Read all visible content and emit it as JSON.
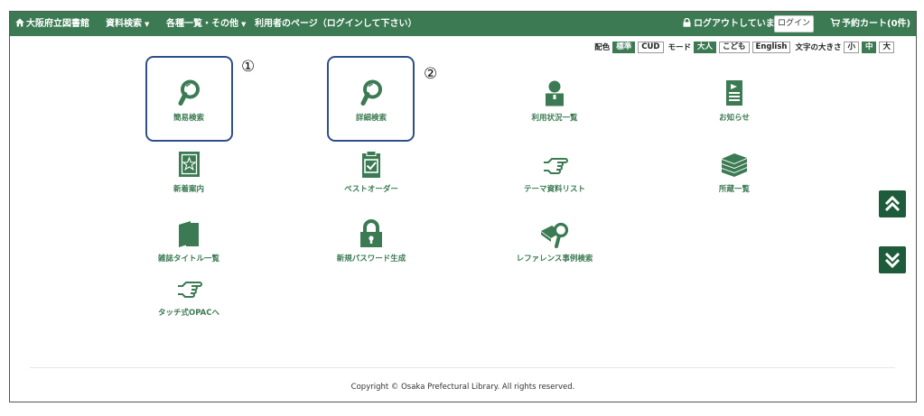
{
  "navbar": {
    "home": "大阪府立図書館",
    "search_menu": "資料検索",
    "lists_menu": "各種一覧・その他",
    "user_page": "利用者のページ（ログインして下さい）",
    "logout_status": "ログアウトしています",
    "login_button": "ログイン",
    "cart": "予約カート(0件)"
  },
  "settings": {
    "color_label": "配色",
    "color_options": [
      "標準",
      "CUD"
    ],
    "mode_label": "モード",
    "mode_options": [
      "大人",
      "こども",
      "English"
    ],
    "size_label": "文字の大きさ",
    "size_options": [
      "小",
      "中",
      "大"
    ],
    "selected_color": "標準",
    "selected_mode": "大人",
    "selected_size": "中"
  },
  "menu": {
    "simple_search": "簡易検索",
    "detail_search": "詳細検索",
    "usage_status": "利用状況一覧",
    "notices": "お知らせ",
    "new_arrivals": "新着案内",
    "best_order": "ベストオーダー",
    "theme_list": "テーマ資料リスト",
    "holdings": "所蔵一覧",
    "magazine_titles": "雑誌タイトル一覧",
    "new_password": "新規パスワード生成",
    "reference_search": "レファレンス事例検索",
    "touch_opac": "タッチ式OPACへ"
  },
  "annotations": {
    "one": "①",
    "two": "②"
  },
  "footer": {
    "copyright": "Copyright © Osaka Prefectural Library. All rights reserved."
  },
  "colors": {
    "brand_green": "#3b7a52",
    "highlight_blue": "#2f4f88",
    "scroll_green": "#1e5b3a"
  },
  "icons": {
    "simple_search": "magnifier-icon",
    "detail_search": "magnifier-icon",
    "usage_status": "person-icon",
    "notices": "notice-document-icon",
    "new_arrivals": "star-book-icon",
    "best_order": "clipboard-check-icon",
    "theme_list": "pointing-hand-icon",
    "holdings": "book-stack-icon",
    "magazine_titles": "magazine-icon",
    "new_password": "padlock-icon",
    "reference_search": "book-magnifier-icon",
    "touch_opac": "pointing-hand-icon",
    "scroll_up": "double-chevron-up-icon",
    "scroll_down": "double-chevron-down-icon"
  }
}
